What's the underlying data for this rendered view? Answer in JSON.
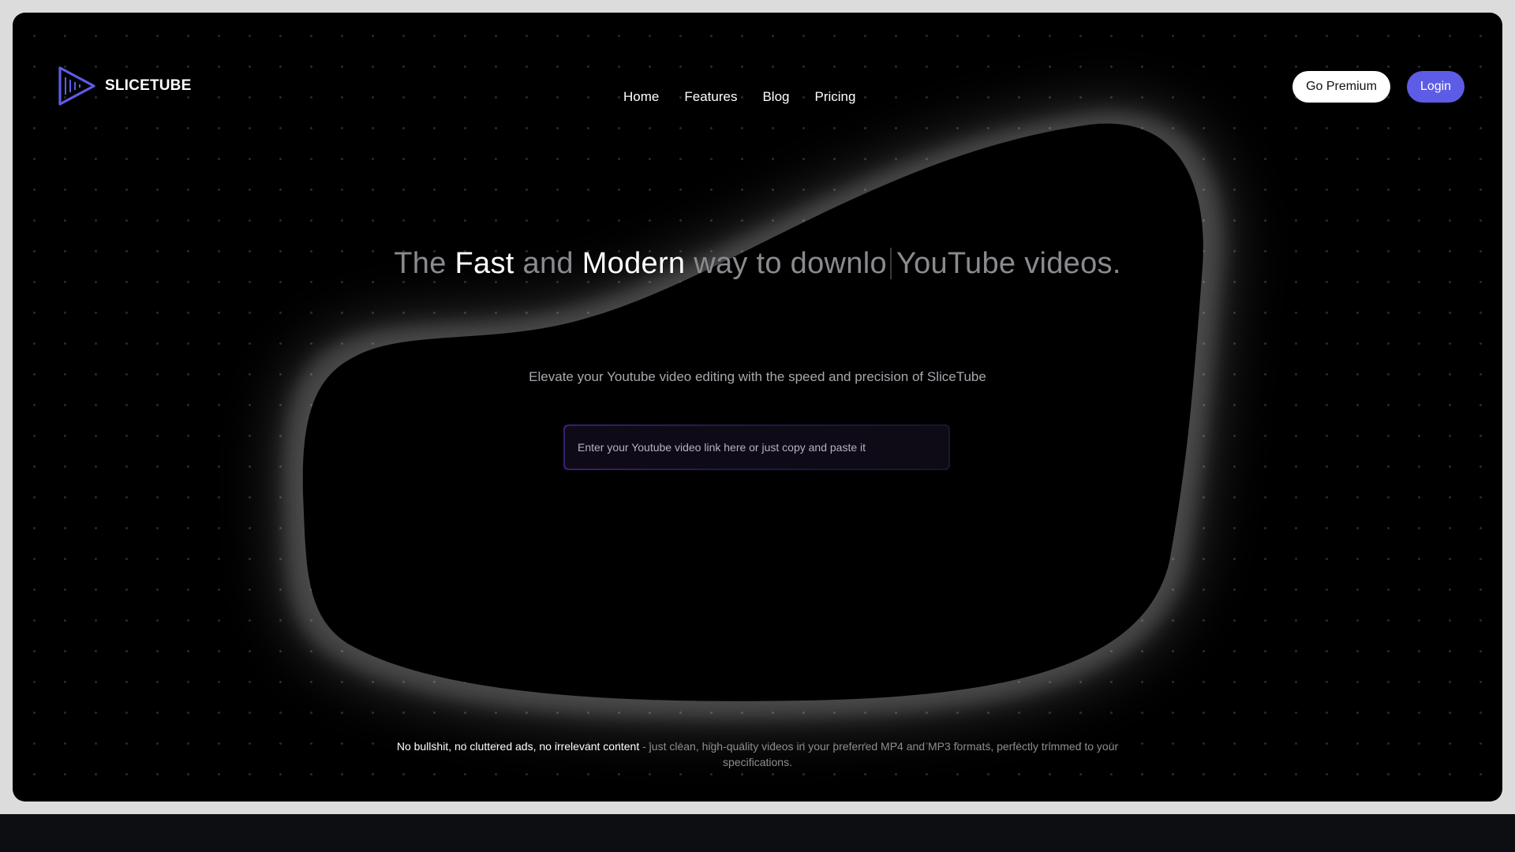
{
  "brand": {
    "name": "SLICETUBE",
    "logo_icon": "play-triangle-logo",
    "accent": "#5d5ce6"
  },
  "nav": {
    "items": [
      {
        "label": "Home"
      },
      {
        "label": "Features"
      },
      {
        "label": "Blog"
      },
      {
        "label": "Pricing"
      }
    ]
  },
  "actions": {
    "premium_label": "Go Premium",
    "login_label": "Login"
  },
  "hero": {
    "headline_parts": [
      "The ",
      "Fast",
      " and ",
      "Modern",
      " way to downlo",
      "YouTube videos."
    ],
    "subtitle": "Elevate your Youtube video editing with the speed and precision of SliceTube",
    "input_placeholder": "Enter your Youtube video link here or just copy and paste it"
  },
  "footer": {
    "strong": "No bullshit, no cluttered ads, no irrelevant content",
    "rest": " - just clean, high-quality videos in your preferred MP4 and MP3 formats, perfectly trimmed to your specifications."
  }
}
